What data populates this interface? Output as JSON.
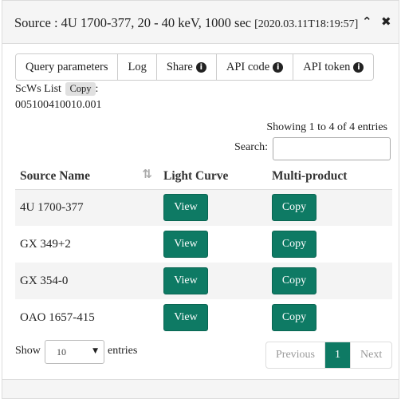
{
  "header": {
    "title": "Source : 4U 1700-377, 20 - 40 keV, 1000 sec",
    "timestamp": "[2020.03.11T18:19:57]",
    "collapse_icon": "chevron-up-icon",
    "close_icon": "close-icon"
  },
  "tabs": [
    {
      "label": "Query parameters",
      "icon": null
    },
    {
      "label": "Log",
      "icon": null
    },
    {
      "label": "Share",
      "icon": "info-icon"
    },
    {
      "label": "API code",
      "icon": "info-icon"
    },
    {
      "label": "API token",
      "icon": "info-icon"
    }
  ],
  "scws": {
    "label": "ScWs List",
    "copy_label": "Copy",
    "suffix": ":",
    "value": "005100410010.001"
  },
  "table": {
    "info": "Showing 1 to 4 of 4 entries",
    "search_label": "Search:",
    "search_value": "",
    "columns": [
      "Source Name",
      "Light Curve",
      "Multi-product"
    ],
    "rows": [
      {
        "name": "4U 1700-377",
        "lc": "View",
        "mp": "Copy"
      },
      {
        "name": "GX 349+2",
        "lc": "View",
        "mp": "Copy"
      },
      {
        "name": "GX 354-0",
        "lc": "View",
        "mp": "Copy"
      },
      {
        "name": "OAO 1657-415",
        "lc": "View",
        "mp": "Copy"
      }
    ]
  },
  "footer": {
    "show_label": "Show",
    "page_size": "10",
    "entries_label": "entries",
    "prev": "Previous",
    "page": "1",
    "next": "Next"
  },
  "colors": {
    "accent": "#0e7a64"
  }
}
